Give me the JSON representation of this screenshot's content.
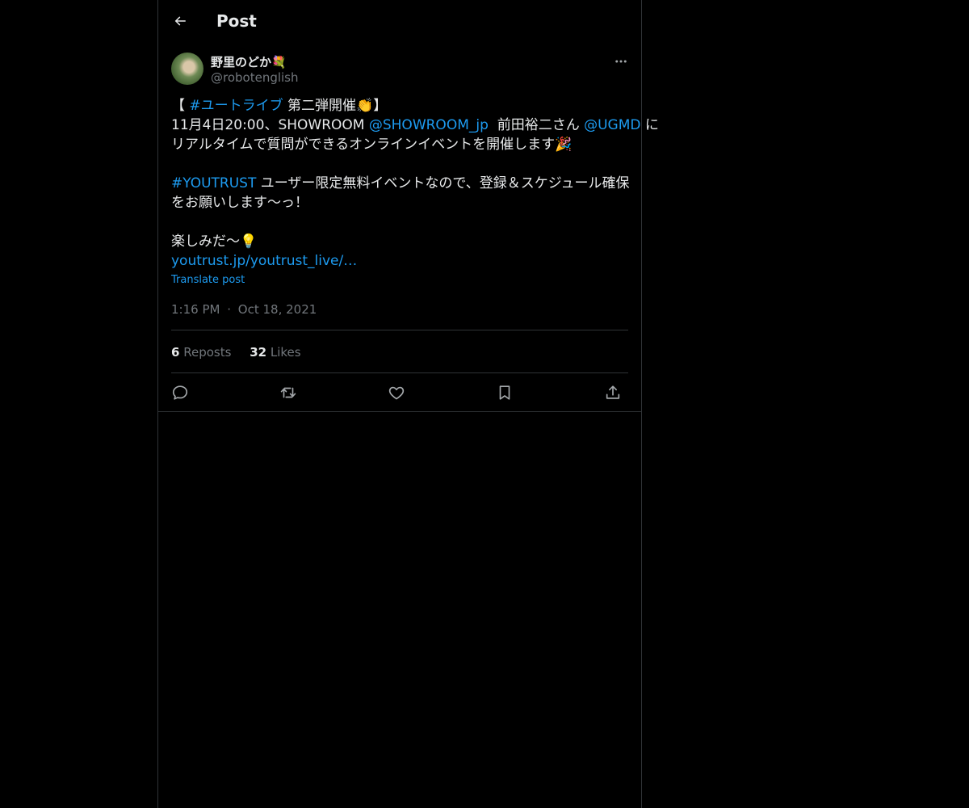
{
  "header": {
    "title": "Post"
  },
  "post": {
    "author": {
      "display_name": "野里のどか💐",
      "handle": "@robotenglish"
    },
    "body": {
      "line1": {
        "pre": "【 ",
        "hashtag": "#ユートライブ",
        "post": " 第二弾開催👏】"
      },
      "line2": {
        "pre": "11月4日20:00、SHOWROOM ",
        "mention1": "@SHOWROOM_jp",
        "mid": "  前田裕二さん ",
        "mention2": "@UGMD",
        "post": " に"
      },
      "line3": "リアルタイムで質問ができるオンラインイベントを開催します🎉",
      "line4": {
        "hashtag": "#YOUTRUST",
        "post": " ユーザー限定無料イベントなので、登録＆スケジュール確保"
      },
      "line5": "をお願いします〜っ！",
      "line6": "楽しみだ〜💡",
      "link": "youtrust.jp/youtrust_live/…"
    },
    "translate_label": "Translate post",
    "time": "1:16 PM",
    "separator": "·",
    "date": "Oct 18, 2021",
    "stats": {
      "reposts_count": "6",
      "reposts_label": "Reposts",
      "likes_count": "32",
      "likes_label": "Likes"
    }
  },
  "icons": {
    "back": "arrow-left-icon",
    "more": "more-dots-icon",
    "reply": "reply-icon",
    "repost": "repost-icon",
    "like": "heart-icon",
    "bookmark": "bookmark-icon",
    "share": "share-icon"
  },
  "colors": {
    "background": "#000000",
    "text": "#e7e9ea",
    "secondary": "#71767b",
    "link": "#1d9bf0",
    "border": "#2f3336"
  }
}
